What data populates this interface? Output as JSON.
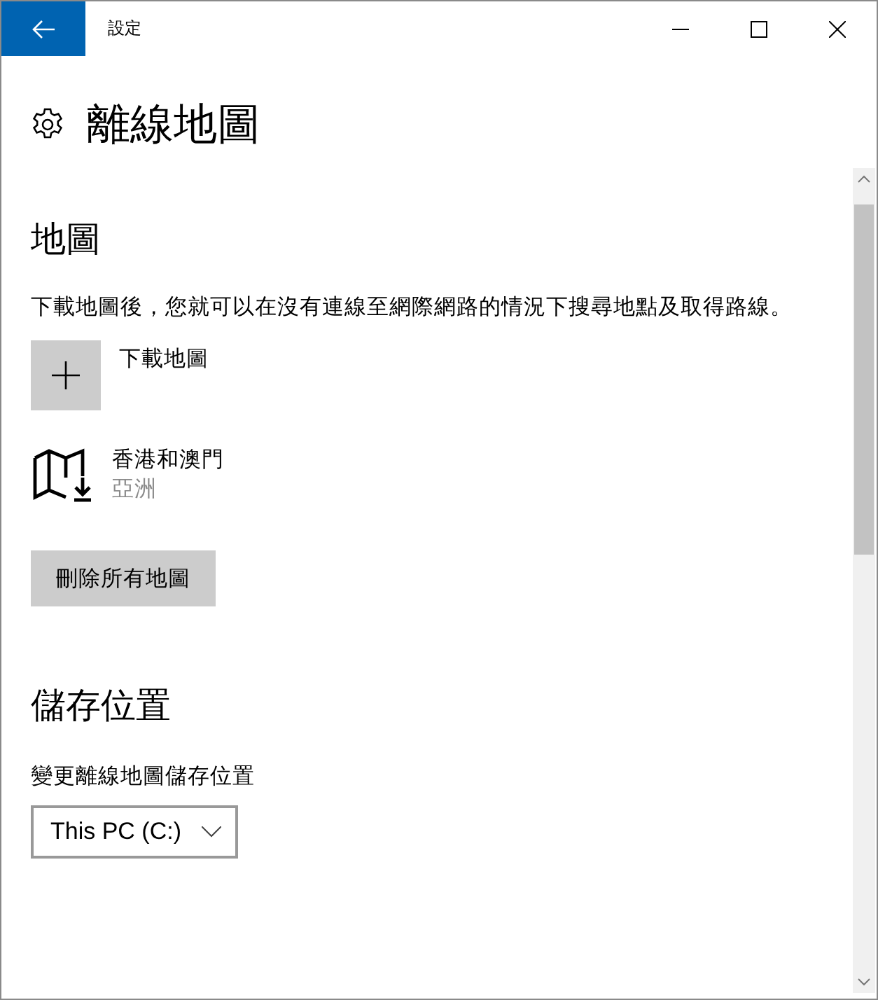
{
  "window": {
    "title": "設定"
  },
  "page_title": "離線地圖",
  "maps_section": {
    "heading": "地圖",
    "description": "下載地圖後，您就可以在沒有連線至網際網路的情況下搜尋地點及取得路線。",
    "download_label": "下載地圖",
    "maps": [
      {
        "name": "香港和澳門",
        "region": "亞洲"
      }
    ],
    "delete_button": "刪除所有地圖"
  },
  "storage_section": {
    "heading": "儲存位置",
    "label": "變更離線地圖儲存位置",
    "dropdown_value": "This PC (C:)"
  }
}
